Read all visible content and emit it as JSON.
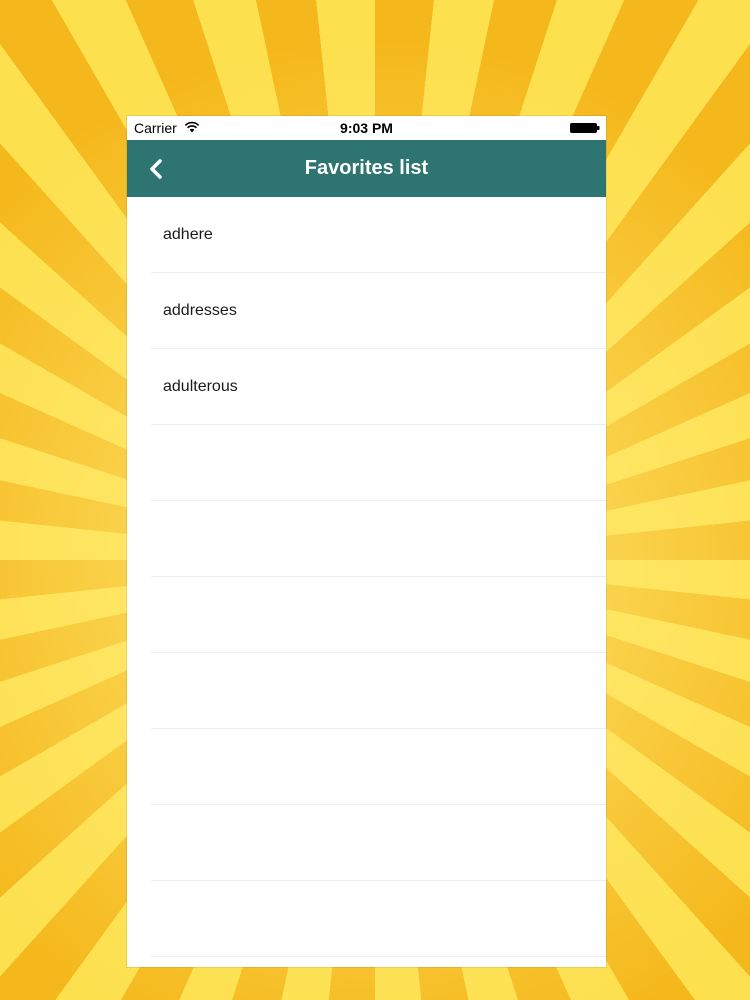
{
  "status_bar": {
    "carrier": "Carrier",
    "time": "9:03 PM",
    "wifi_icon": "wifi-icon",
    "battery_icon": "battery-icon"
  },
  "nav_bar": {
    "title": "Favorites list",
    "back_icon": "chevron-left-icon",
    "background_color": "#2e7572"
  },
  "favorites": {
    "items": [
      {
        "label": "adhere"
      },
      {
        "label": "addresses"
      },
      {
        "label": "adulterous"
      },
      {
        "label": ""
      },
      {
        "label": ""
      },
      {
        "label": ""
      },
      {
        "label": ""
      },
      {
        "label": ""
      },
      {
        "label": ""
      },
      {
        "label": ""
      },
      {
        "label": ""
      }
    ]
  }
}
